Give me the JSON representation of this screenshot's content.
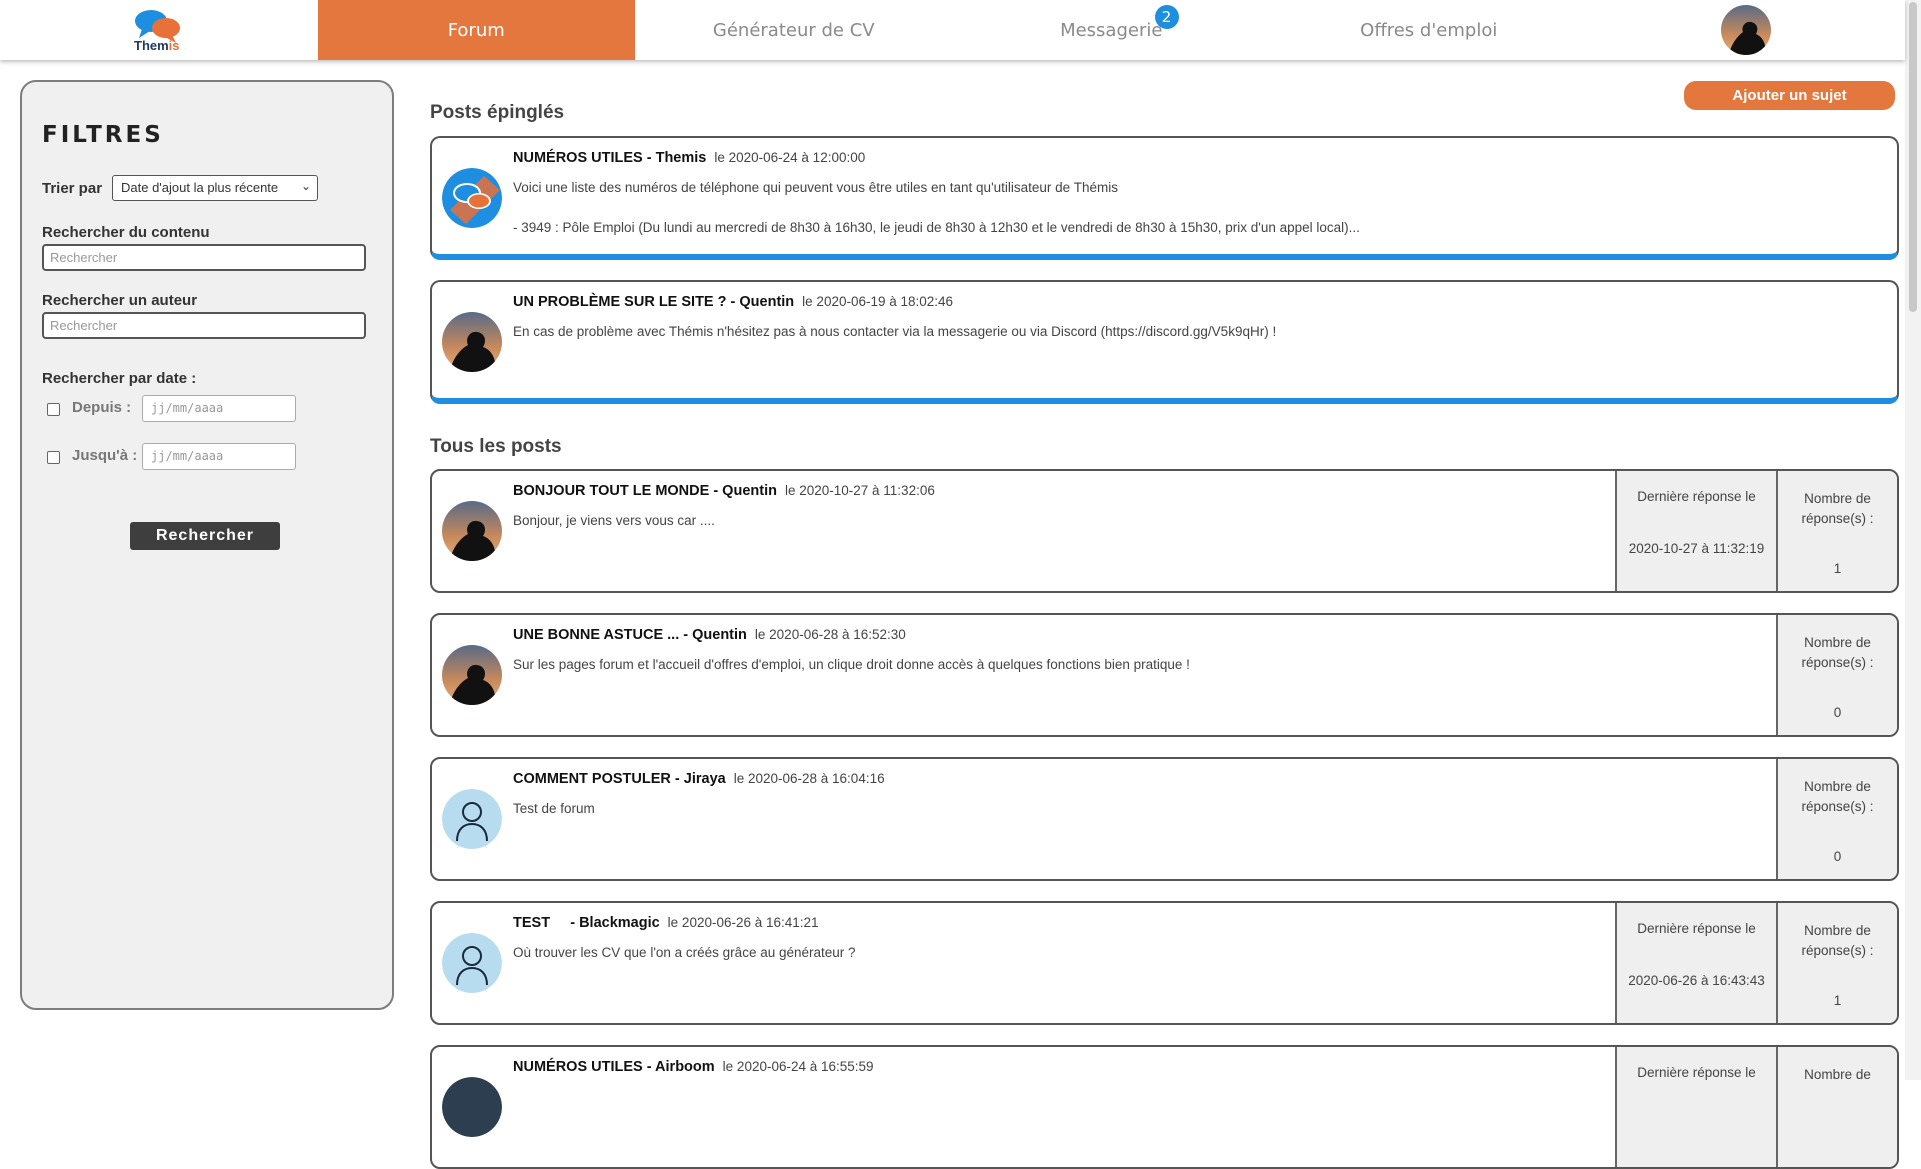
{
  "nav": {
    "logo_text_a": "Them",
    "logo_text_b": "is",
    "items": [
      {
        "label": "Forum"
      },
      {
        "label": "Générateur de CV"
      },
      {
        "label": "Messagerie",
        "badge": "2"
      },
      {
        "label": "Offres d'emploi"
      }
    ]
  },
  "filters": {
    "title": "FILTRES",
    "sort_label": "Trier par",
    "sort_value": "Date d'ajout la plus récente",
    "content_label": "Rechercher du contenu",
    "content_placeholder": "Rechercher",
    "author_label": "Rechercher un auteur",
    "author_placeholder": "Rechercher",
    "date_label": "Rechercher par date :",
    "from_label": "Depuis :",
    "to_label": "Jusqu'à :",
    "date_placeholder": "jj/mm/aaaa",
    "search_button": "Rechercher"
  },
  "main": {
    "add_button": "Ajouter un sujet",
    "pinned_title": "Posts épinglés",
    "all_title": "Tous les posts",
    "last_reply_label": "Dernière réponse le",
    "reply_count_label_1": "Nombre de",
    "reply_count_label_2": "réponse(s) :"
  },
  "pinned": [
    {
      "title": "NUMÉROS UTILES",
      "author": " - Themis",
      "date": "le 2020-06-24 à 12:00:00",
      "body": "Voici une liste des numéros de téléphone qui peuvent vous être utiles en tant qu'utilisateur de Thémis",
      "body2": "- 3949 : Pôle Emploi (Du lundi au mercredi de 8h30 à 16h30, le jeudi de 8h30 à 12h30 et le vendredi de 8h30 à 15h30, prix d'un appel local)..."
    },
    {
      "title": "UN PROBLÈME SUR LE SITE ?",
      "author": " - Quentin",
      "date": "le 2020-06-19 à 18:02:46",
      "body": "En cas de problème avec Thémis n'hésitez pas à nous contacter via la messagerie ou via Discord (https://discord.gg/V5k9qHr) !"
    }
  ],
  "posts": [
    {
      "title": "BONJOUR TOUT LE MONDE",
      "author": " - Quentin",
      "date": "le 2020-10-27 à 11:32:06",
      "body": "Bonjour, je viens vers vous car ....",
      "last_reply": "2020-10-27 à 11:32:19",
      "replies": "1"
    },
    {
      "title": "UNE BONNE ASTUCE ...",
      "author": " - Quentin",
      "date": "le 2020-06-28 à 16:52:30",
      "body": "Sur les pages forum et l'accueil d'offres d'emploi, un clique droit donne accès à quelques fonctions bien pratique !",
      "replies": "0"
    },
    {
      "title": "COMMENT POSTULER",
      "author": " - Jiraya",
      "date": "le 2020-06-28 à 16:04:16",
      "body": "Test de forum",
      "replies": "0"
    },
    {
      "title": "TEST",
      "author": "     - Blackmagic",
      "date": "le 2020-06-26 à 16:41:21",
      "body": "Où trouver les CV que l'on a créés grâce au générateur ?",
      "last_reply": "2020-06-26 à 16:43:43",
      "replies": "1"
    },
    {
      "title": "NUMÉROS UTILES",
      "author": " - Airboom",
      "date": "le 2020-06-24 à 16:55:59",
      "body": ""
    }
  ],
  "colors": {
    "accent": "#e4773e",
    "pinned_bar": "#1e8fe0",
    "badge": "#1e8fe0"
  }
}
